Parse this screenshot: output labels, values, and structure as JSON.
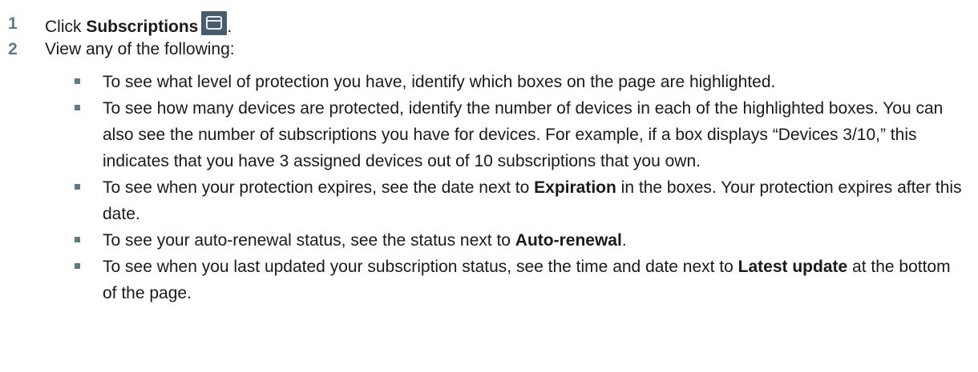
{
  "steps": [
    {
      "number": "1",
      "text_before": "Click ",
      "bold": "Subscriptions",
      "text_after": ".",
      "icon": "subscriptions-icon",
      "icon_color": "#4a5b6b"
    },
    {
      "number": "2",
      "text": "View any of the following:"
    }
  ],
  "bullets": [
    {
      "text": "To see what level of protection you have, identify which boxes on the page are highlighted."
    },
    {
      "text": "To see how many devices are protected, identify the number of devices in each of the highlighted boxes. You can also see the number of subscriptions you have for devices. For example, if a box displays “Devices 3/10,” this indicates that you have 3 assigned devices out of 10 subscriptions that you own."
    },
    {
      "before": "To see when your protection expires, see the date next to ",
      "bold": "Expiration",
      "after": " in the boxes. Your protection expires after this date."
    },
    {
      "before": "To see your auto-renewal status, see the status next to ",
      "bold": "Auto-renewal",
      "after": "."
    },
    {
      "before": "To see when you last updated your subscription status, see the time and date next to ",
      "bold": "Latest update",
      "after": " at the bottom of the page."
    }
  ],
  "colors": {
    "step_number": "#5f7a85",
    "bullet": "#5f7a85",
    "text": "#1a1a1a"
  }
}
